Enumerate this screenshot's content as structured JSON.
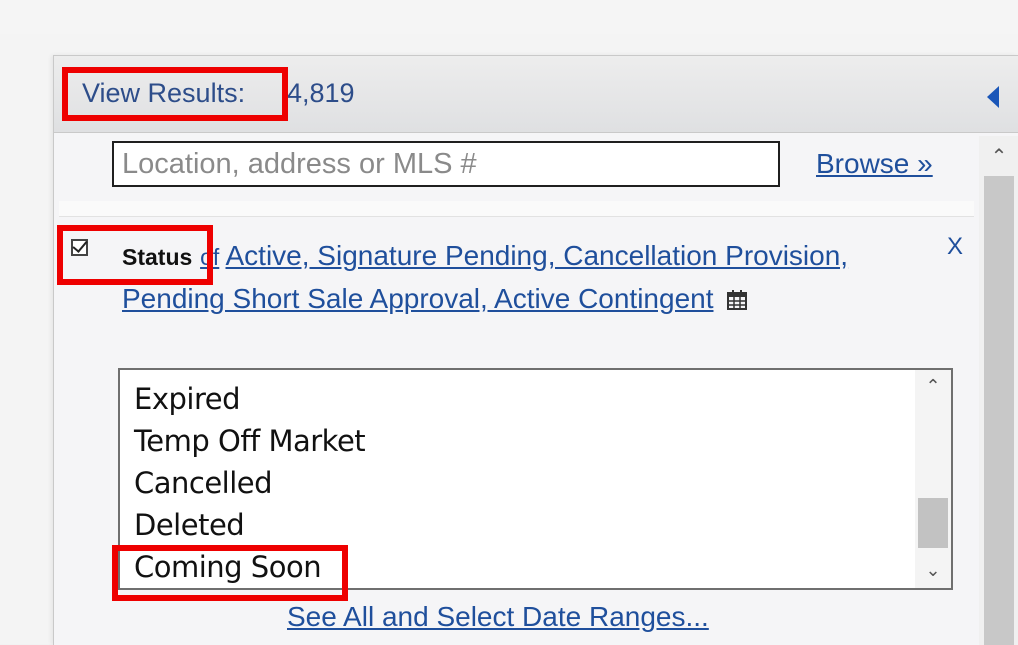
{
  "results": {
    "label": "View Results:",
    "count": "4,819"
  },
  "search": {
    "placeholder": "Location, address or MLS #",
    "value": "",
    "browse_label": "Browse »"
  },
  "status_filter": {
    "label": "Status",
    "connector": "of",
    "values_text": "Active, Signature Pending, Cancellation Provision, Pending Short Sale Approval, Active Contingent",
    "checked": true,
    "remove_label": "X",
    "icon": "calendar-icon"
  },
  "status_options": [
    "Expired",
    "Temp Off Market",
    "Cancelled",
    "Deleted",
    "Coming Soon"
  ],
  "see_all_label": "See All and Select Date Ranges...",
  "colors": {
    "link": "#1f4f9c",
    "highlight": "#ee0000",
    "header_text": "#2d4d8a"
  }
}
